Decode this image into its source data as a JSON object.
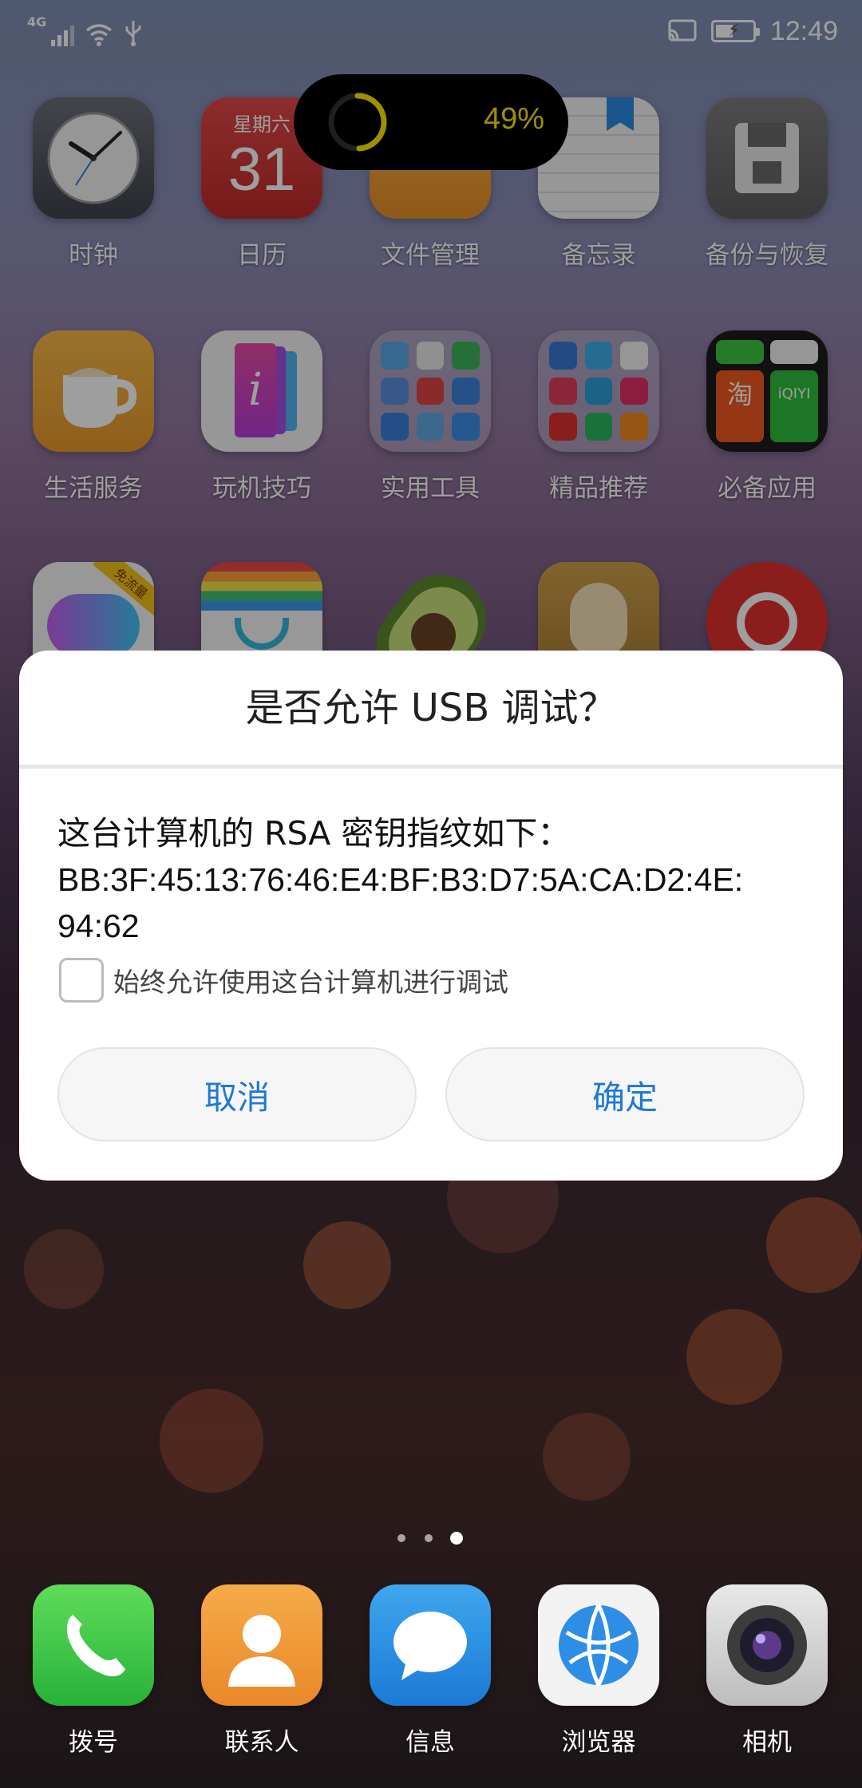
{
  "status_bar": {
    "network": "4G",
    "time": "12:49",
    "battery_level": 0.49
  },
  "battery_popup": {
    "percent_text": "49%",
    "percent_color": "#ffe900"
  },
  "home": {
    "row1": [
      {
        "label": "时钟",
        "icon": "clock-icon"
      },
      {
        "label": "日历",
        "icon": "calendar-icon",
        "weekday": "星期六",
        "day": "31"
      },
      {
        "label": "文件管理",
        "icon": "folder-icon"
      },
      {
        "label": "备忘录",
        "icon": "notepad-icon"
      },
      {
        "label": "备份与恢复",
        "icon": "floppy-disk-icon"
      }
    ],
    "row2": [
      {
        "label": "生活服务",
        "icon": "coffee-cup-icon"
      },
      {
        "label": "玩机技巧",
        "icon": "tips-icon"
      },
      {
        "label": "实用工具",
        "icon": "tools-folder-icon"
      },
      {
        "label": "精品推荐",
        "icon": "recommend-folder-icon"
      },
      {
        "label": "必备应用",
        "icon": "essentials-folder-icon",
        "sub_labels": [
          "淘",
          "iQIYI"
        ]
      }
    ],
    "row3": [
      {
        "icon": "cloud-music-icon",
        "badge": "免流量"
      },
      {
        "icon": "shopping-icon"
      },
      {
        "icon": "avocado-icon"
      },
      {
        "icon": "doge-icon"
      },
      {
        "icon": "netease-music-icon"
      }
    ]
  },
  "dialog": {
    "title": "是否允许 USB 调试？",
    "fingerprint_label": "这台计算机的 RSA 密钥指纹如下：",
    "fingerprint_value": "BB:3F:45:13:76:46:E4:BF:B3:D7:5A:CA:D2:4E:",
    "fingerprint_value_2": "94:62",
    "checkbox_label": "始终允许使用这台计算机进行调试",
    "cancel_label": "取消",
    "ok_label": "确定",
    "accent_color": "#1e78d7"
  },
  "page_indicator": {
    "pages": 3,
    "current": 3
  },
  "dock": [
    {
      "label": "拨号",
      "icon": "phone-icon"
    },
    {
      "label": "联系人",
      "icon": "contacts-icon"
    },
    {
      "label": "信息",
      "icon": "message-icon"
    },
    {
      "label": "浏览器",
      "icon": "browser-icon"
    },
    {
      "label": "相机",
      "icon": "camera-icon"
    }
  ]
}
